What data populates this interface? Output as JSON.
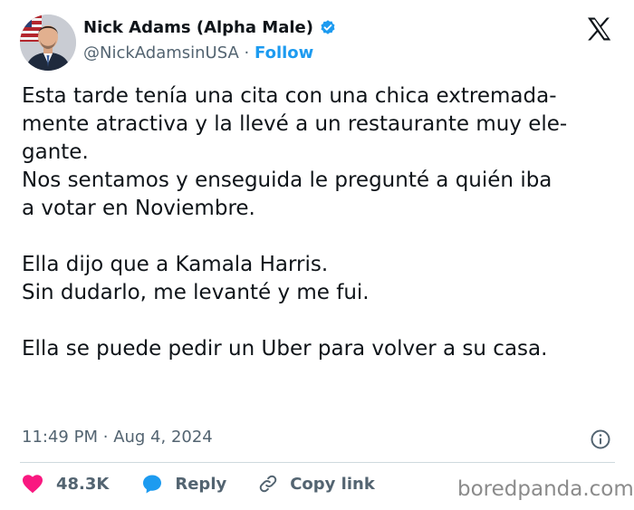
{
  "author": {
    "display_name": "Nick Adams (Alpha Male)",
    "handle": "@NickAdamsinUSA",
    "separator": "·",
    "follow_label": "Follow",
    "verified_icon": "verified-badge-icon",
    "avatar_icon": "profile-photo-avatar"
  },
  "platform_icon": "x-logo-icon",
  "tweet": {
    "paragraphs": [
      "Esta tarde tenía una cita con una chica extremada-",
      "mente atractiva y la llevé a un restaurante muy ele-",
      "gante.",
      "Nos sentamos y enseguida le pregunté a quién iba",
      "a votar en Noviembre.",
      "",
      "Ella dijo que a Kamala Harris.",
      "Sin dudarlo, me levanté y me fui.",
      "",
      "Ella se puede pedir un Uber para volver a su casa."
    ]
  },
  "meta": {
    "time": "11:49 PM",
    "separator": "·",
    "date": "Aug 4, 2024",
    "info_icon": "info-icon"
  },
  "actions": {
    "like_count": "48.3K",
    "like_icon": "heart-icon",
    "reply_label": "Reply",
    "reply_icon": "speech-bubble-icon",
    "copy_label": "Copy link",
    "copy_icon": "link-icon"
  },
  "watermark": "boredpanda.com",
  "colors": {
    "text": "#0f1419",
    "secondary": "#536471",
    "accent": "#1d9bf0",
    "like": "#f91880",
    "divider": "#cfd9de"
  }
}
